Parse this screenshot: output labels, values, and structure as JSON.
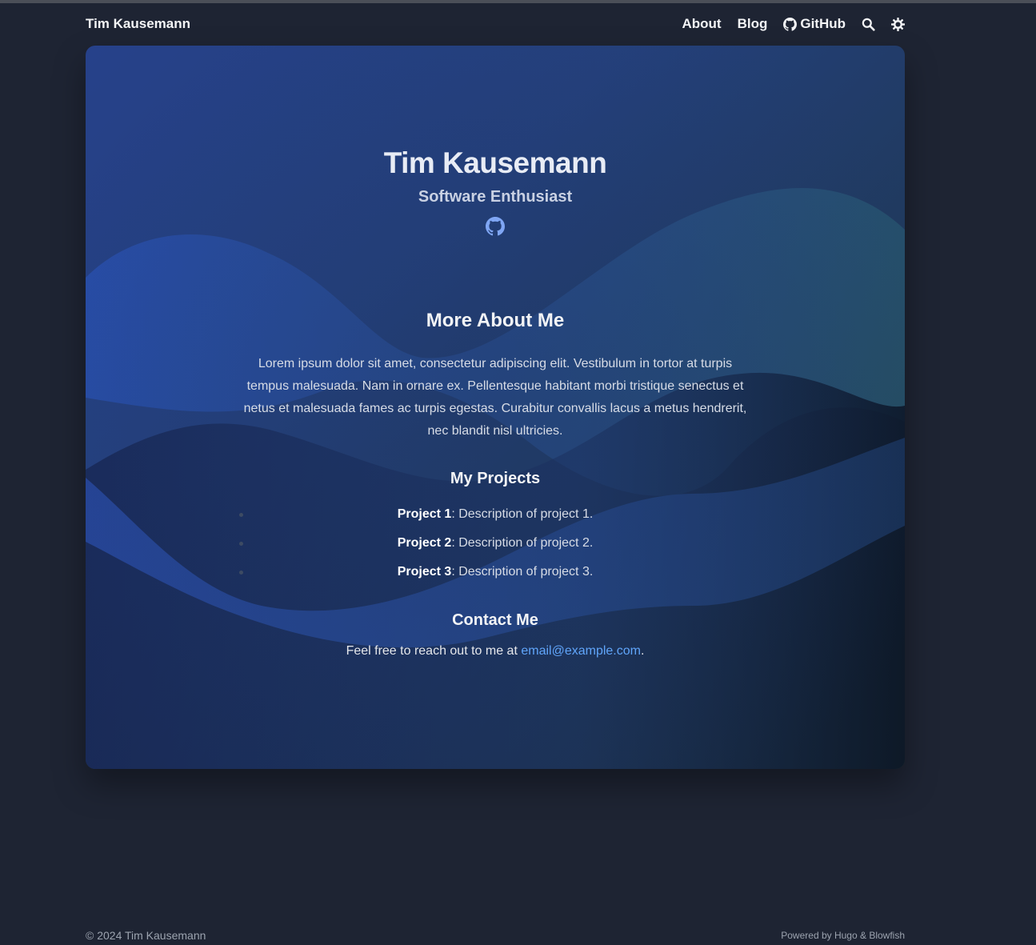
{
  "header": {
    "site_title": "Tim Kausemann",
    "nav": [
      {
        "label": "About"
      },
      {
        "label": "Blog"
      },
      {
        "label": "GitHub",
        "icon": "github-icon"
      }
    ],
    "search_icon": "search-icon",
    "theme_icon": "sun-icon"
  },
  "hero": {
    "name": "Tim Kausemann",
    "subtitle": "Software Enthusiast",
    "social_icon": "github-icon"
  },
  "content": {
    "about_heading": "More About Me",
    "about_text": "Lorem ipsum dolor sit amet, consectetur adipiscing elit. Vestibulum in tortor at turpis tempus malesuada. Nam in ornare ex. Pellentesque habitant morbi tristique senectus et netus et malesuada fames ac turpis egestas. Curabitur convallis lacus a metus hendrerit, nec blandit nisl ultricies.",
    "projects_heading": "My Projects",
    "projects": [
      {
        "name": "Project 1",
        "desc": ": Description of project 1."
      },
      {
        "name": "Project 2",
        "desc": ": Description of project 2."
      },
      {
        "name": "Project 3",
        "desc": ": Description of project 3."
      }
    ],
    "contact_heading": "Contact Me",
    "contact_prefix": "Feel free to reach out to me at ",
    "contact_email": "email@example.com",
    "contact_suffix": "."
  },
  "footer": {
    "copyright": "© 2024 Tim Kausemann",
    "powered": "Powered by Hugo & Blowfish"
  },
  "colors": {
    "background": "#1e2433",
    "link": "#60a5fa"
  }
}
